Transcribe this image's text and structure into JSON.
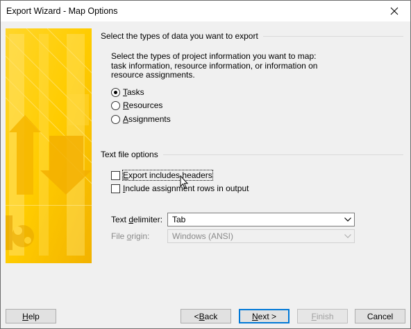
{
  "window": {
    "title": "Export Wizard - Map Options"
  },
  "section_types": {
    "heading": "Select the types of data you want to export"
  },
  "description": "Select the types of project information you want to map: task information, resource information, or information on resource assignments.",
  "radios": [
    {
      "label": "Tasks",
      "mnemonic": "T",
      "rest": "asks",
      "selected": true
    },
    {
      "label": "Resources",
      "mnemonic": "R",
      "rest": "esources",
      "selected": false
    },
    {
      "label": "Assignments",
      "mnemonic": "A",
      "rest": "ssignments",
      "selected": false
    }
  ],
  "section_textfile": {
    "heading": "Text file options"
  },
  "checkboxes": [
    {
      "label": "Export includes headers",
      "mnemonic": "E",
      "rest": "xport includes headers",
      "checked": false
    },
    {
      "label": "Include assignment rows in output",
      "mnemonic": "I",
      "rest": "nclude assignment rows in output",
      "checked": false
    }
  ],
  "delimiter": {
    "label_pre": "Text ",
    "mnemonic": "d",
    "label_post": "elimiter:",
    "value": "Tab"
  },
  "origin": {
    "label_pre": "File ",
    "mnemonic": "o",
    "label_post": "rigin:",
    "value": "Windows (ANSI)"
  },
  "buttons": {
    "help": {
      "mnemonic": "H",
      "rest": "elp"
    },
    "back": {
      "prefix": "< ",
      "mnemonic": "B",
      "rest": "ack"
    },
    "next": {
      "mnemonic": "N",
      "rest": "ext >"
    },
    "finish": {
      "mnemonic": "F",
      "rest": "inish"
    },
    "cancel": "Cancel"
  }
}
